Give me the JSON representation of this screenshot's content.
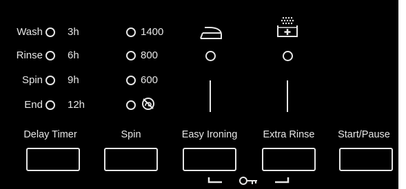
{
  "status": {
    "labels": [
      "Wash",
      "Rinse",
      "Spin",
      "End"
    ]
  },
  "delay_timer": {
    "options": [
      "3h",
      "6h",
      "9h",
      "12h"
    ]
  },
  "spin_speed": {
    "options": [
      "1400",
      "800",
      "600"
    ],
    "no_spin_icon": "no-spin-icon"
  },
  "options_icons": {
    "easy_ironing": "iron-icon",
    "extra_rinse": "extra-rinse-icon"
  },
  "buttons": {
    "delay_timer": "Delay Timer",
    "spin": "Spin",
    "easy_ironing": "Easy Ironing",
    "extra_rinse": "Extra Rinse",
    "start_pause": "Start/Pause"
  },
  "child_lock": {
    "icon": "key-icon"
  },
  "colors": {
    "panel": "#000000",
    "foreground": "#e6e6e6"
  }
}
